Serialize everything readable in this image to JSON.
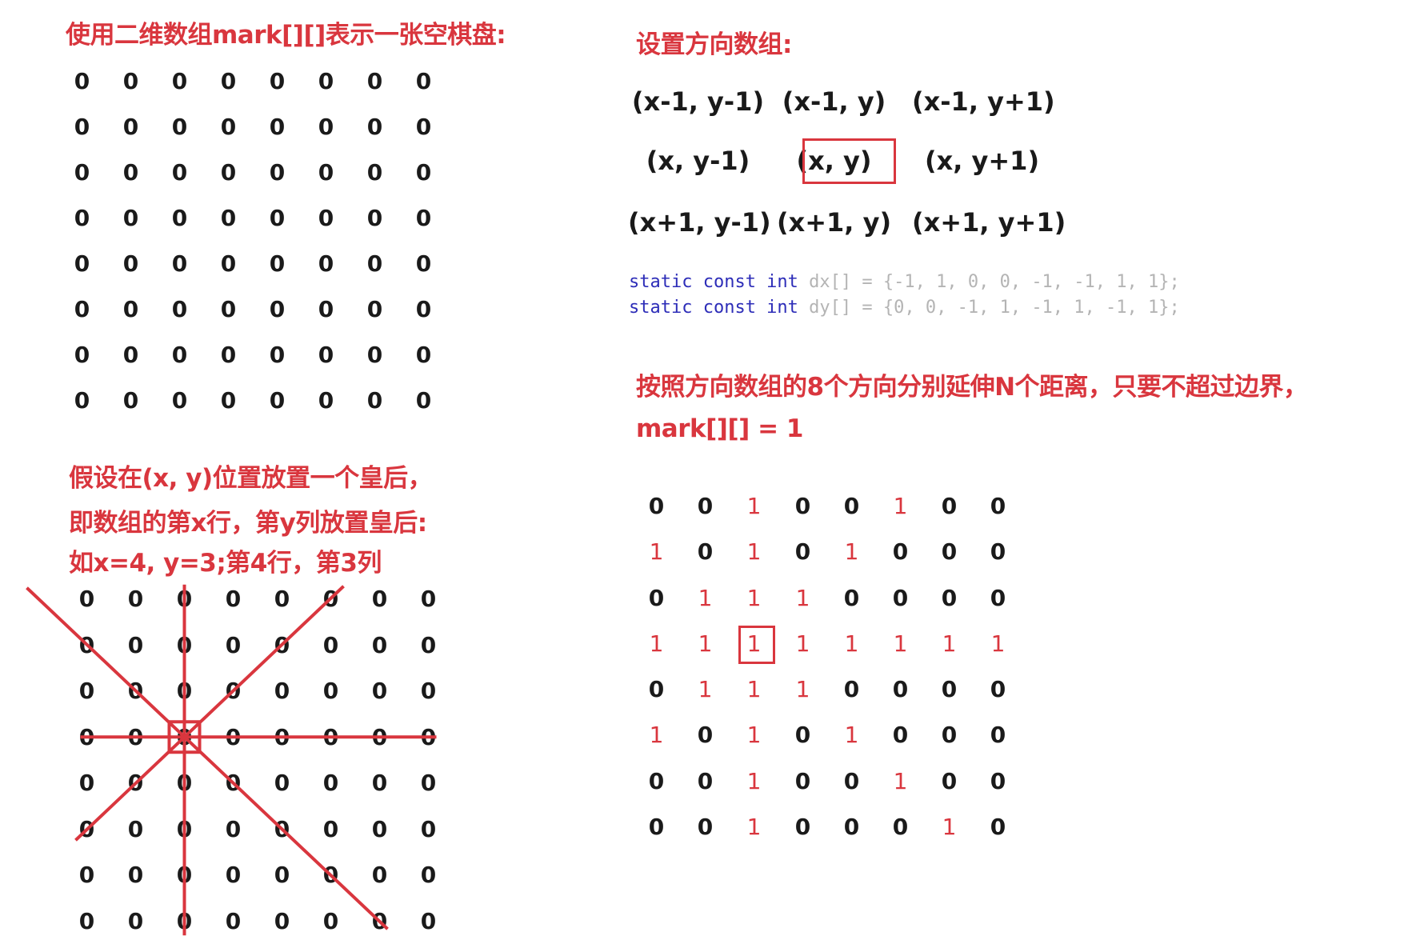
{
  "top_left": {
    "title": "使用二维数组mark[][]表示一张空棋盘:",
    "grid": [
      [
        "0",
        "0",
        "0",
        "0",
        "0",
        "0",
        "0",
        "0"
      ],
      [
        "0",
        "0",
        "0",
        "0",
        "0",
        "0",
        "0",
        "0"
      ],
      [
        "0",
        "0",
        "0",
        "0",
        "0",
        "0",
        "0",
        "0"
      ],
      [
        "0",
        "0",
        "0",
        "0",
        "0",
        "0",
        "0",
        "0"
      ],
      [
        "0",
        "0",
        "0",
        "0",
        "0",
        "0",
        "0",
        "0"
      ],
      [
        "0",
        "0",
        "0",
        "0",
        "0",
        "0",
        "0",
        "0"
      ],
      [
        "0",
        "0",
        "0",
        "0",
        "0",
        "0",
        "0",
        "0"
      ],
      [
        "0",
        "0",
        "0",
        "0",
        "0",
        "0",
        "0",
        "0"
      ]
    ]
  },
  "bottom_left": {
    "line1": "假设在(x, y)位置放置一个皇后，",
    "line2": "即数组的第x行，第y列放置皇后:",
    "line3": "如x=4, y=3;第4行，第3列",
    "queen_row": 4,
    "queen_col": 3,
    "grid": [
      [
        "0",
        "0",
        "0",
        "0",
        "0",
        "0",
        "0",
        "0"
      ],
      [
        "0",
        "0",
        "0",
        "0",
        "0",
        "0",
        "0",
        "0"
      ],
      [
        "0",
        "0",
        "0",
        "0",
        "0",
        "0",
        "0",
        "0"
      ],
      [
        "0",
        "0",
        "0",
        "0",
        "0",
        "0",
        "0",
        "0"
      ],
      [
        "0",
        "0",
        "0",
        "0",
        "0",
        "0",
        "0",
        "0"
      ],
      [
        "0",
        "0",
        "0",
        "0",
        "0",
        "0",
        "0",
        "0"
      ],
      [
        "0",
        "0",
        "0",
        "0",
        "0",
        "0",
        "0",
        "0"
      ],
      [
        "0",
        "0",
        "0",
        "0",
        "0",
        "0",
        "0",
        "0"
      ]
    ]
  },
  "top_right": {
    "title": "设置方向数组:",
    "directions": [
      [
        "(x-1, y-1)",
        "(x-1, y)",
        "(x-1, y+1)"
      ],
      [
        "(x, y-1)",
        "(x, y)",
        "(x, y+1)"
      ],
      [
        "(x+1, y-1)",
        "(x+1, y)",
        "(x+1, y+1)"
      ]
    ],
    "code": {
      "keywords": "static const int",
      "line1_rest": " dx[] = {-1, 1, 0, 0, -1, -1, 1, 1};",
      "line2_rest": " dy[] = {0, 0, -1, 1, -1, 1, -1, 1};"
    }
  },
  "bottom_right": {
    "line1": "按照方向数组的8个方向分别延伸N个距离，只要不超过边界，",
    "line2": "mark[][] = 1",
    "highlight_row": 4,
    "highlight_col": 3,
    "grid": [
      [
        "0",
        "0",
        "1",
        "0",
        "0",
        "1",
        "0",
        "0"
      ],
      [
        "1",
        "0",
        "1",
        "0",
        "1",
        "0",
        "0",
        "0"
      ],
      [
        "0",
        "1",
        "1",
        "1",
        "0",
        "0",
        "0",
        "0"
      ],
      [
        "1",
        "1",
        "1",
        "1",
        "1",
        "1",
        "1",
        "1"
      ],
      [
        "0",
        "1",
        "1",
        "1",
        "0",
        "0",
        "0",
        "0"
      ],
      [
        "1",
        "0",
        "1",
        "0",
        "1",
        "0",
        "0",
        "0"
      ],
      [
        "0",
        "0",
        "1",
        "0",
        "0",
        "1",
        "0",
        "0"
      ],
      [
        "0",
        "0",
        "1",
        "0",
        "0",
        "0",
        "1",
        "0"
      ]
    ]
  },
  "colors": {
    "accent_red": "#d9363e",
    "text_dark": "#1a1a1a",
    "code_keyword": "#2d2db8",
    "code_gray": "#b4b4b4"
  }
}
